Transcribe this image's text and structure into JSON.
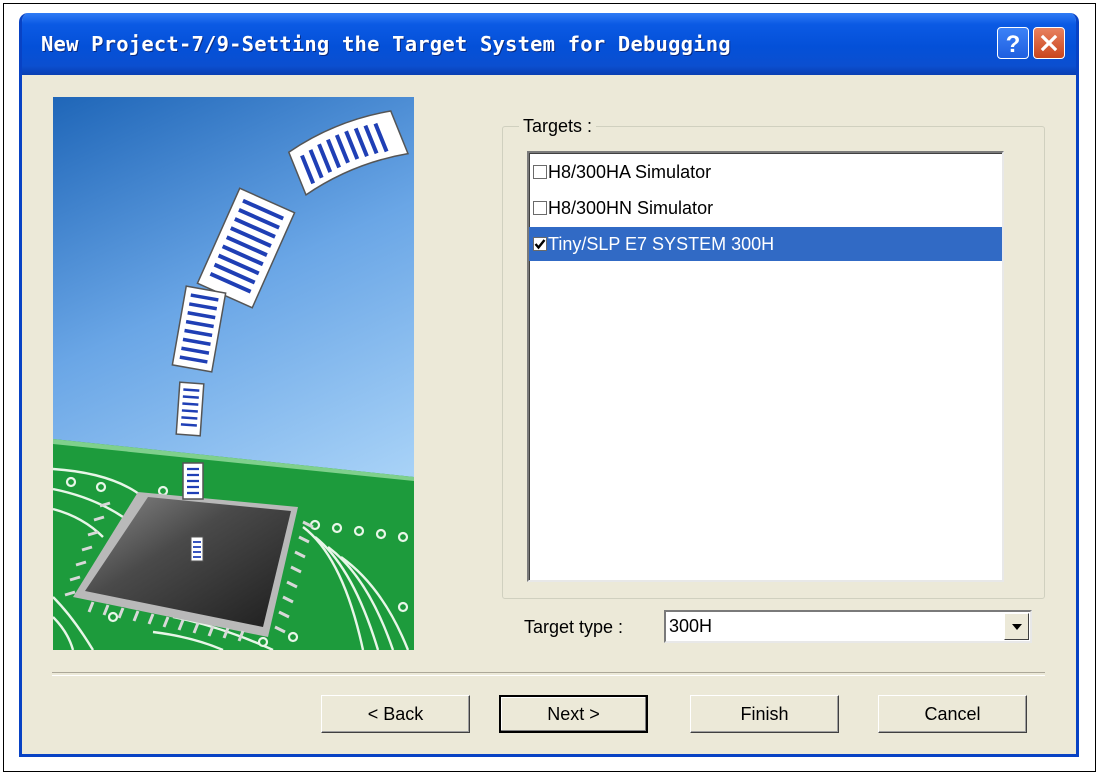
{
  "window": {
    "title": "New Project-7/9-Setting the Target System for Debugging",
    "help_icon": "help-icon",
    "close_icon": "close-icon"
  },
  "targets": {
    "group_label": "Targets :",
    "items": [
      {
        "label": "H8/300HA Simulator",
        "checked": false,
        "selected": false
      },
      {
        "label": "H8/300HN Simulator",
        "checked": false,
        "selected": false
      },
      {
        "label": "Tiny/SLP E7 SYSTEM 300H",
        "checked": true,
        "selected": true
      }
    ]
  },
  "target_type": {
    "label": "Target type :",
    "value": "300H"
  },
  "buttons": {
    "back": "< Back",
    "next": "Next >",
    "finish": "Finish",
    "cancel": "Cancel"
  },
  "colors": {
    "title_bar": "#0450d8",
    "dialog_bg": "#ece9d8",
    "selection": "#316ac5",
    "close_button": "#d8542a"
  }
}
